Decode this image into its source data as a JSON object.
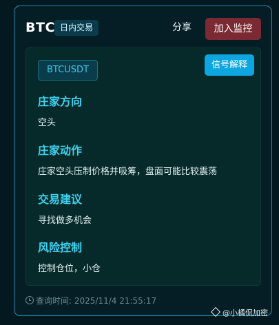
{
  "header": {
    "coin": "BTC",
    "mode_badge": "日内交易",
    "share_label": "分享",
    "monitor_label": "加入监控"
  },
  "card": {
    "symbol": "BTCUSDT",
    "signal_button": "信号解释",
    "sections": [
      {
        "title": "庄家方向",
        "text": "空头"
      },
      {
        "title": "庄家动作",
        "text": "庄家空头压制价格并吸筹，盘面可能比较震荡"
      },
      {
        "title": "交易建议",
        "text": "寻找做多机会"
      },
      {
        "title": "风险控制",
        "text": "控制仓位，小仓"
      }
    ]
  },
  "footer": {
    "query_time_label": "查询时间: 2025/11/4 21:55:17"
  },
  "watermark": {
    "text": "@小橘侃加密"
  },
  "colors": {
    "background": "#03181f",
    "card_border": "#1f8fb8",
    "accent_cyan": "#3fd1f0",
    "signal_button": "#0da6e0",
    "monitor_button": "#7b2a33"
  }
}
